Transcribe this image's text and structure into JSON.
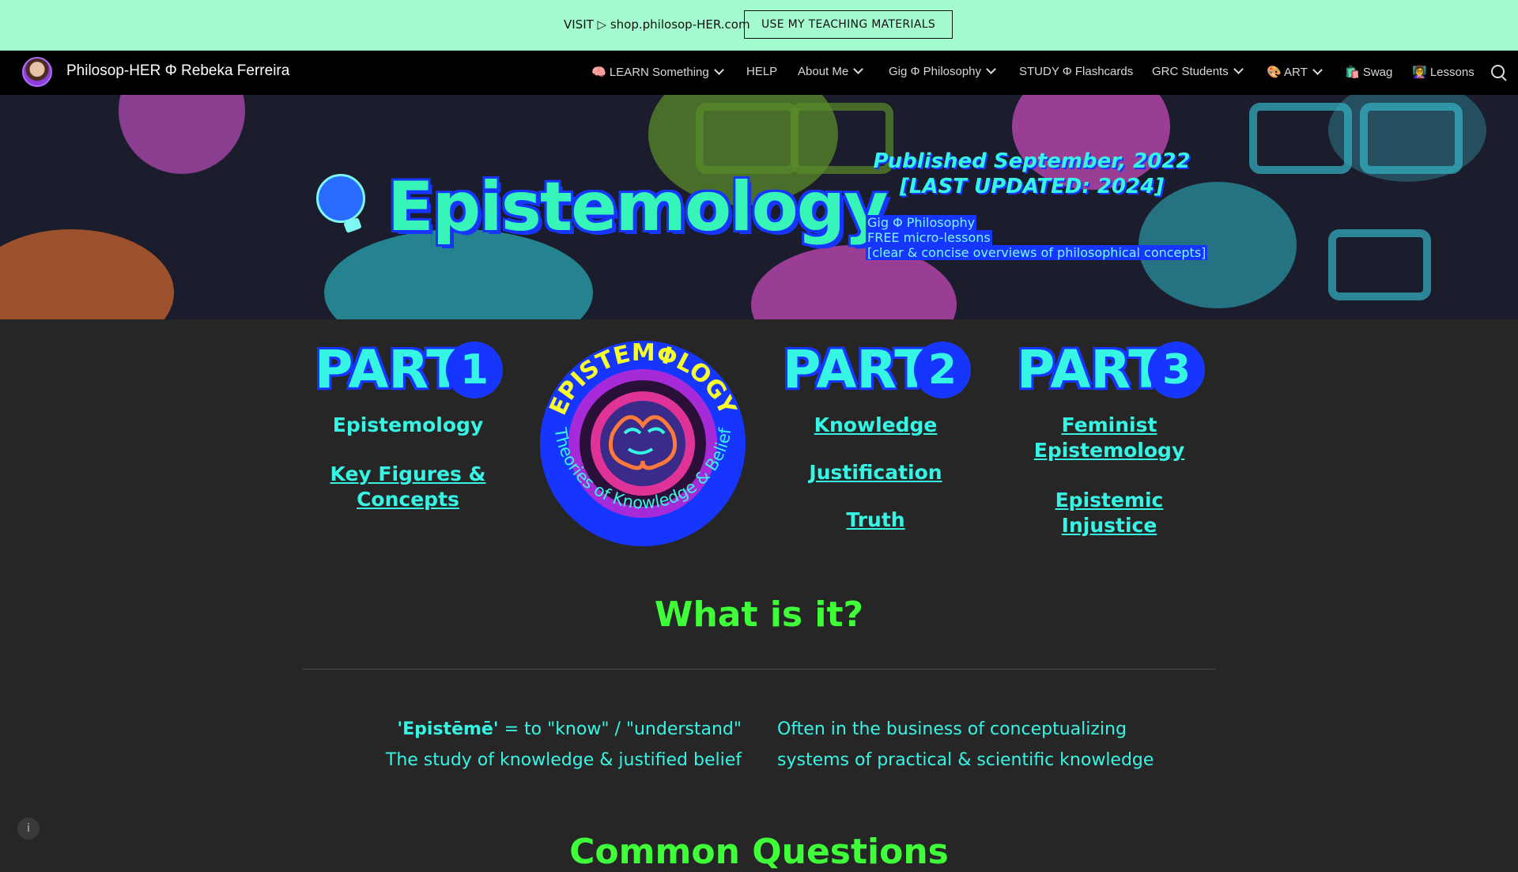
{
  "banner": {
    "visit_text": "VISIT ▷ shop.philosop-HER.com",
    "cta_label": "USE MY TEACHING MATERIALS"
  },
  "nav": {
    "site_title": "Philosop-HER Φ Rebeka Ferreira",
    "items": [
      {
        "label": "🧠 LEARN Something",
        "dropdown": true
      },
      {
        "label": "HELP",
        "dropdown": false
      },
      {
        "label": "About Me",
        "dropdown": true
      },
      {
        "label": "Gig Φ Philosophy",
        "dropdown": true
      },
      {
        "label": "STUDY Φ Flashcards",
        "dropdown": false
      },
      {
        "label": "GRC Students",
        "dropdown": true
      },
      {
        "label": "🎨 ART",
        "dropdown": true
      },
      {
        "label": "🛍️ Swag",
        "dropdown": false
      },
      {
        "label": "👩‍🏫 Lessons",
        "dropdown": false
      }
    ],
    "search_icon": "search-icon"
  },
  "hero": {
    "title": "Epistemology",
    "published": "Published September, 2022 [LAST UPDATED: 2024]",
    "sub_lines": [
      "Gig Φ Philosophy",
      "FREE micro-lessons",
      "[clear & concise overviews of philosophical concepts]"
    ]
  },
  "parts": [
    {
      "word": "PART",
      "num": "1",
      "links": [
        "Epistemology",
        "Key Figures & Concepts"
      ]
    },
    {
      "word": "PART",
      "num": "2",
      "links": [
        "Knowledge",
        "Justification",
        "Truth"
      ]
    },
    {
      "word": "PART",
      "num": "3",
      "links": [
        "Feminist Epistemology",
        "Epistemic Injustice"
      ]
    }
  ],
  "emblem": {
    "top_text": "EPISTEMΦLOGY",
    "bottom_text": "Theories of Knowledge & Belief"
  },
  "what": {
    "heading": "What is it?",
    "term": "'Epistēmē'",
    "term_def": " = to \"know\" / \"understand\"",
    "left_line2": "The study of knowledge & justified belief",
    "right_line1": "Often in the business of conceptualizing",
    "right_line2": "systems of practical & scientific knowledge"
  },
  "next_heading": "Common Questions",
  "colors": {
    "accent": "#37f5e4",
    "heading": "#3fff38",
    "banner": "#a5fbd0",
    "blue": "#1636ff"
  }
}
